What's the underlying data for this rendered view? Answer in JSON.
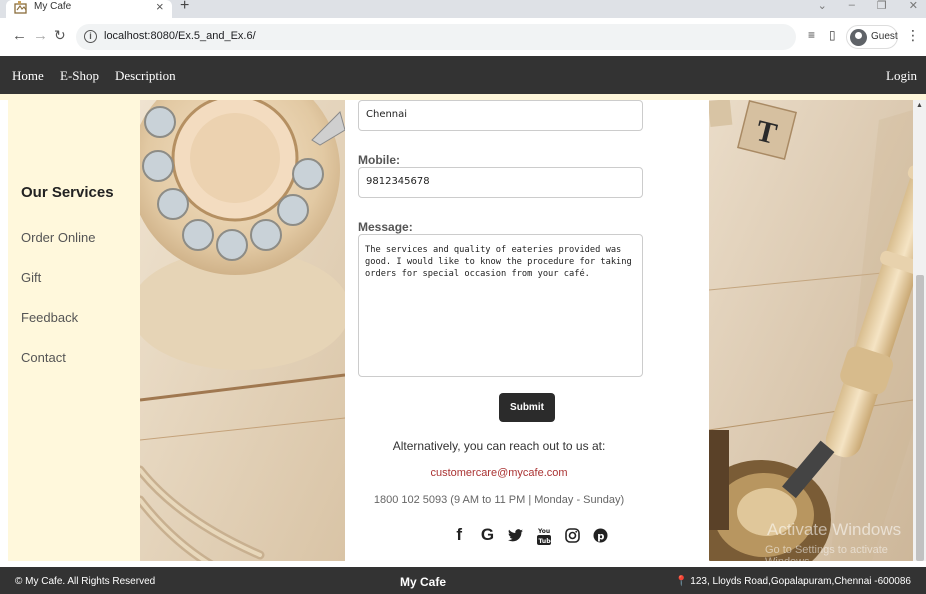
{
  "browser": {
    "tab_title": "My Cafe",
    "url": "localhost:8080/Ex.5_and_Ex.6/",
    "profile_label": "Guest"
  },
  "nav": {
    "left_links": [
      "Home",
      "E-Shop",
      "Description"
    ],
    "login": "Login"
  },
  "sidebar": {
    "title": "Our Services",
    "items": [
      "Order Online",
      "Gift",
      "Feedback",
      "Contact"
    ]
  },
  "form": {
    "city_value": "Chennai",
    "mobile_label": "Mobile:",
    "mobile_value": "9812345678",
    "message_label": "Message:",
    "message_value": "The services and quality of eateries provided was\ngood. I would like to know the procedure for taking\norders for special occasion from your café.",
    "submit_label": "Submit"
  },
  "contact": {
    "reach_text": "Alternatively, you can reach out to us at:",
    "email": "customercare@mycafe.com",
    "phone": "1800 102 5093 (9 AM to 11 PM | Monday - Sunday)",
    "social_icons": [
      "facebook-icon",
      "google-icon",
      "twitter-icon",
      "youtube-icon",
      "instagram-icon",
      "pinterest-icon"
    ]
  },
  "watermark": {
    "title": "Activate Windows",
    "subtitle": "Go to Settings to activate Windows."
  },
  "footer": {
    "copyright": "© My Cafe. All Rights Reserved",
    "brand": "My Cafe",
    "address": "123, Lloyds Road,Gopalapuram,Chennai -600086"
  },
  "colors": {
    "nav_bg": "#333333",
    "sidebar_bg": "#fff8dc",
    "email_link": "#aa3333",
    "submit_bg": "#2b2b2b"
  }
}
